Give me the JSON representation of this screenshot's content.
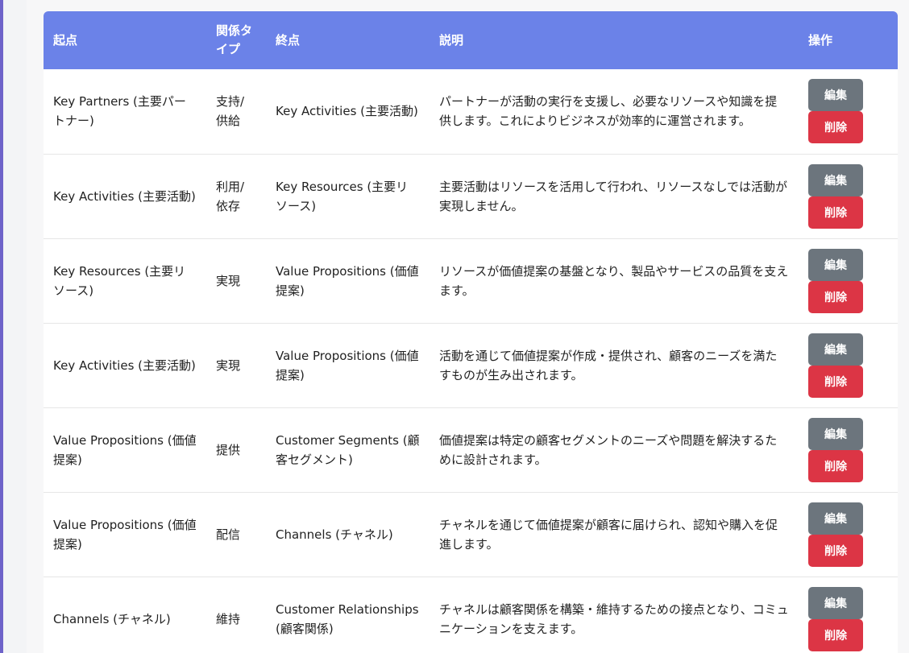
{
  "table": {
    "headers": {
      "source": "起点",
      "relation_type": "関係タイプ",
      "target": "終点",
      "description": "説明",
      "actions": "操作"
    },
    "edit_label": "編集",
    "delete_label": "削除",
    "rows": [
      {
        "source": "Key Partners (主要パートナー)",
        "relation_type": "支持/供給",
        "target": "Key Activities (主要活動)",
        "description": "パートナーが活動の実行を支援し、必要なリソースや知識を提供します。これによりビジネスが効率的に運営されます。"
      },
      {
        "source": "Key Activities (主要活動)",
        "relation_type": "利用/依存",
        "target": "Key Resources (主要リソース)",
        "description": "主要活動はリソースを活用して行われ、リソースなしでは活動が実現しません。"
      },
      {
        "source": "Key Resources (主要リソース)",
        "relation_type": "実現",
        "target": "Value Propositions (価値提案)",
        "description": "リソースが価値提案の基盤となり、製品やサービスの品質を支えます。"
      },
      {
        "source": "Key Activities (主要活動)",
        "relation_type": "実現",
        "target": "Value Propositions (価値提案)",
        "description": "活動を通じて価値提案が作成・提供され、顧客のニーズを満たすものが生み出されます。"
      },
      {
        "source": "Value Propositions (価値提案)",
        "relation_type": "提供",
        "target": "Customer Segments (顧客セグメント)",
        "description": "価値提案は特定の顧客セグメントのニーズや問題を解決するために設計されます。"
      },
      {
        "source": "Value Propositions (価値提案)",
        "relation_type": "配信",
        "target": "Channels (チャネル)",
        "description": "チャネルを通じて価値提案が顧客に届けられ、認知や購入を促進します。"
      },
      {
        "source": "Channels (チャネル)",
        "relation_type": "維持",
        "target": "Customer Relationships (顧客関係)",
        "description": "チャネルは顧客関係を構築・維持するための接点となり、コミュニケーションを支えます。"
      }
    ]
  }
}
